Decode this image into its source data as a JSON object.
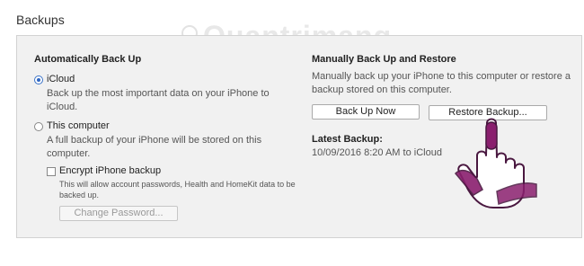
{
  "section_title": "Backups",
  "watermark": "Quantrimang",
  "auto": {
    "heading": "Automatically Back Up",
    "icloud_label": "iCloud",
    "icloud_desc_1": "Back up the most important data on your iPhone to",
    "icloud_desc_2": "iCloud.",
    "computer_label": "This computer",
    "computer_desc_1": "A full backup of your iPhone will be stored on this",
    "computer_desc_2": "computer.",
    "encrypt_label": "Encrypt iPhone backup",
    "encrypt_desc_1": "This will allow account passwords, Health and HomeKit data to be",
    "encrypt_desc_2": "backed up.",
    "change_password_label": "Change Password...",
    "selected": "iCloud",
    "encrypt_checked": false
  },
  "manual": {
    "heading": "Manually Back Up and Restore",
    "desc_1": "Manually back up your iPhone to this computer or restore a",
    "desc_2": "backup stored on this computer.",
    "back_up_now_label": "Back Up Now",
    "restore_label": "Restore Backup...",
    "latest_heading": "Latest Backup:",
    "latest_value": "10/09/2016 8:20 AM to iCloud"
  },
  "icons": {
    "pointer": "hand-pointer-icon",
    "watermark_logo": "lightbulb-icon"
  }
}
